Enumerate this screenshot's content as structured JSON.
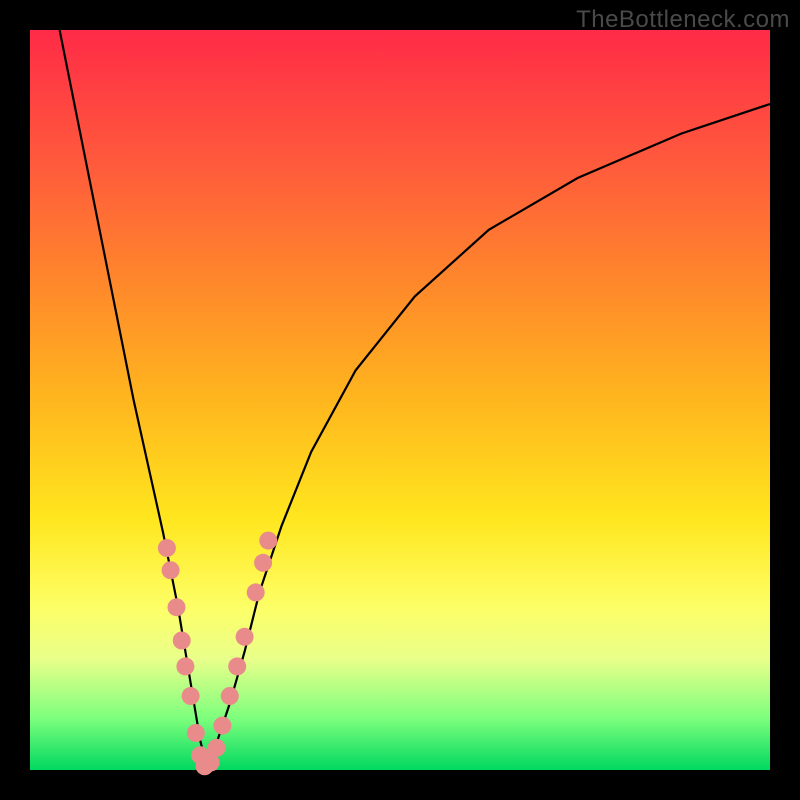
{
  "watermark": "TheBottleneck.com",
  "chart_data": {
    "type": "line",
    "title": "",
    "xlabel": "",
    "ylabel": "",
    "xlim": [
      0,
      100
    ],
    "ylim": [
      0,
      100
    ],
    "series": [
      {
        "name": "bottleneck-curve",
        "x": [
          4,
          6,
          8,
          10,
          12,
          14,
          16,
          18,
          19,
          20,
          21,
          22,
          23,
          24,
          25,
          27,
          29,
          31,
          34,
          38,
          44,
          52,
          62,
          74,
          88,
          100
        ],
        "y": [
          100,
          90,
          80,
          70,
          60,
          50,
          41,
          32,
          27,
          22,
          16,
          10,
          4,
          0,
          3,
          9,
          16,
          24,
          33,
          43,
          54,
          64,
          73,
          80,
          86,
          90
        ]
      }
    ],
    "markers": {
      "name": "salmon-dots",
      "color": "#e98b8b",
      "points": [
        {
          "x": 18.5,
          "y": 30
        },
        {
          "x": 19.0,
          "y": 27
        },
        {
          "x": 19.8,
          "y": 22
        },
        {
          "x": 20.5,
          "y": 17.5
        },
        {
          "x": 21.0,
          "y": 14
        },
        {
          "x": 21.7,
          "y": 10
        },
        {
          "x": 22.4,
          "y": 5
        },
        {
          "x": 23.0,
          "y": 2
        },
        {
          "x": 23.6,
          "y": 0.5
        },
        {
          "x": 24.4,
          "y": 1
        },
        {
          "x": 25.2,
          "y": 3
        },
        {
          "x": 26.0,
          "y": 6
        },
        {
          "x": 27.0,
          "y": 10
        },
        {
          "x": 28.0,
          "y": 14
        },
        {
          "x": 29.0,
          "y": 18
        },
        {
          "x": 30.5,
          "y": 24
        },
        {
          "x": 31.5,
          "y": 28
        },
        {
          "x": 32.2,
          "y": 31
        }
      ]
    }
  }
}
